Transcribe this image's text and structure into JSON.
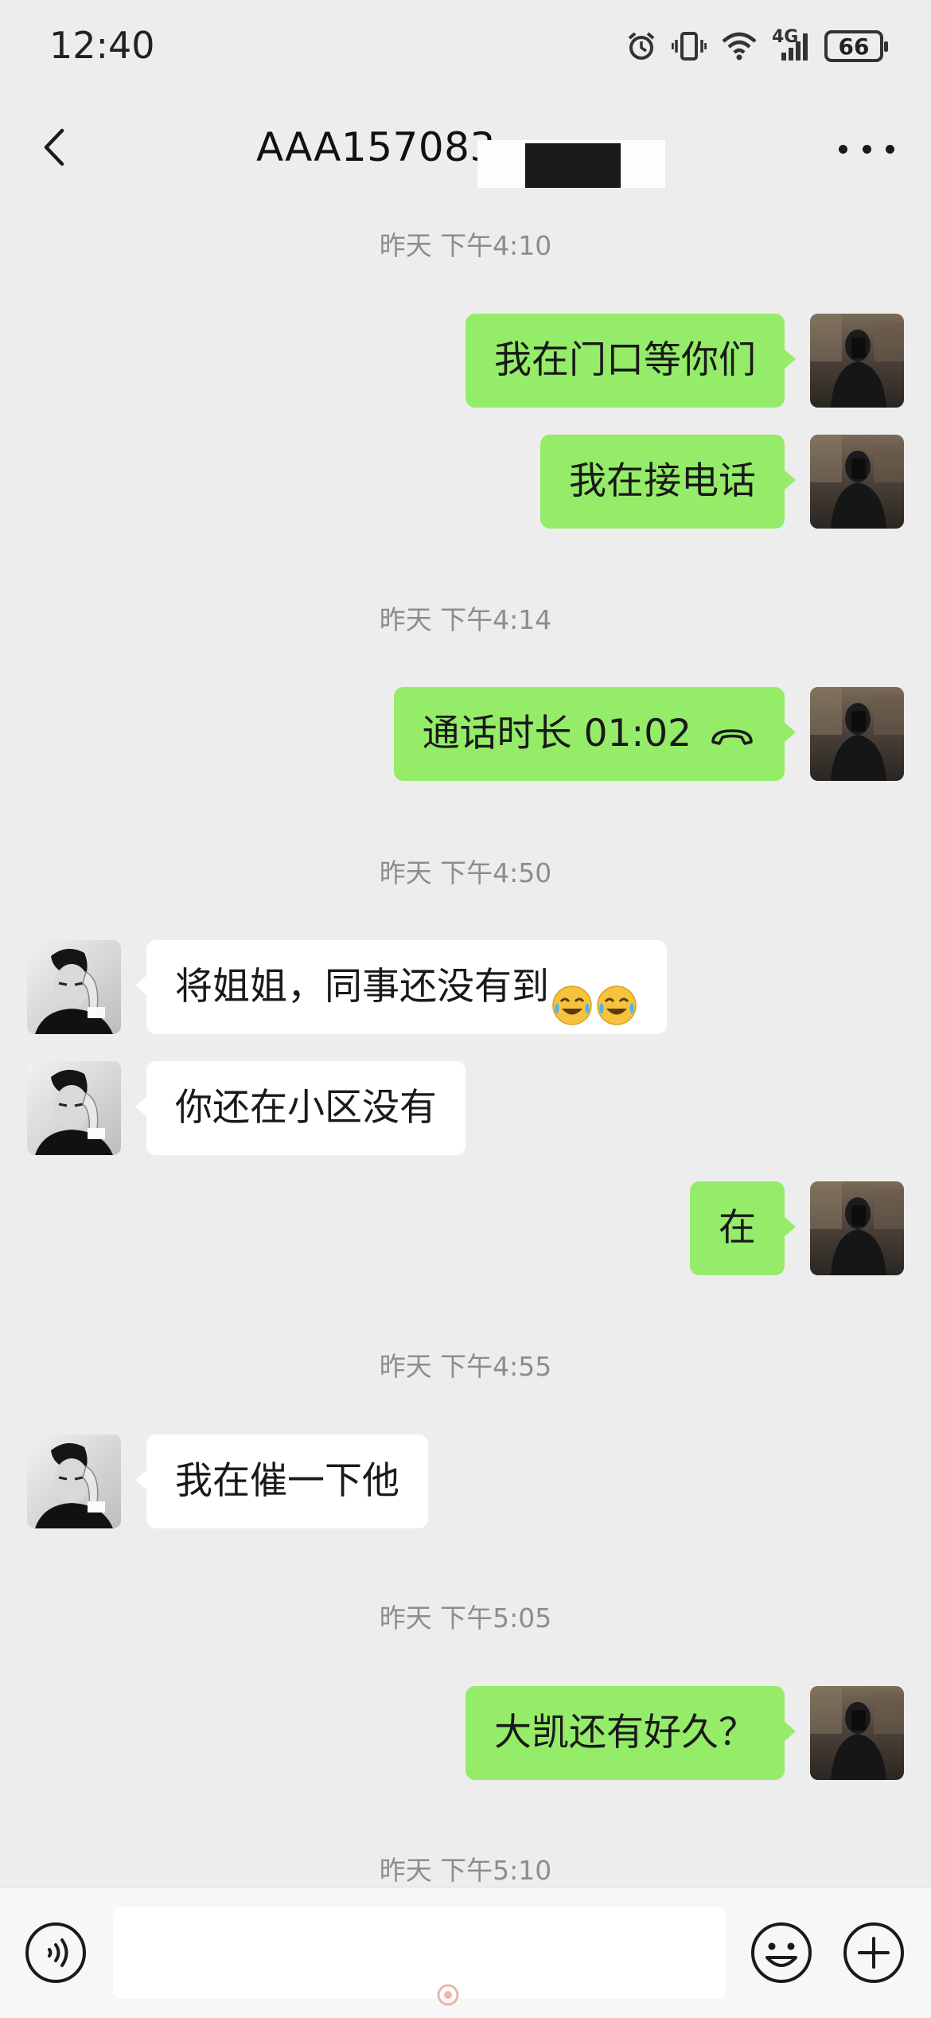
{
  "status_bar": {
    "time": "12:40",
    "network_label": "4G",
    "battery": "66",
    "icons": [
      "alarm-icon",
      "vibrate-icon",
      "wifi-icon",
      "cellular-signal-icon",
      "battery-icon"
    ]
  },
  "header": {
    "title": "AAA157083",
    "back_icon": "chevron-left-icon",
    "more_icon": "more-dots-icon"
  },
  "timestamps": [
    "昨天 下午4:10",
    "昨天 下午4:14",
    "昨天 下午4:50",
    "昨天 下午4:55",
    "昨天 下午5:05",
    "昨天 下午5:10"
  ],
  "messages": [
    {
      "sender": "me",
      "text": "我在门口等你们"
    },
    {
      "sender": "me",
      "text": "我在接电话"
    },
    {
      "sender": "me",
      "text": "通话时长 01:02",
      "icon": "phone-hangup-icon"
    },
    {
      "sender": "other",
      "text": "将姐姐，同事还没有到",
      "emoji": [
        "crying-laughing-emoji",
        "crying-laughing-emoji"
      ]
    },
    {
      "sender": "other",
      "text": "你还在小区没有"
    },
    {
      "sender": "me",
      "text": "在"
    },
    {
      "sender": "other",
      "text": "我在催一下他"
    },
    {
      "sender": "me",
      "text": "大凯还有好久？"
    }
  ],
  "input_bar": {
    "value": "",
    "icons": [
      "voice-icon",
      "emoji-icon",
      "plus-icon"
    ]
  },
  "colors": {
    "background": "#ededed",
    "my_bubble": "#95ec69",
    "other_bubble": "#ffffff",
    "timestamp_text": "#8d8d8d"
  }
}
